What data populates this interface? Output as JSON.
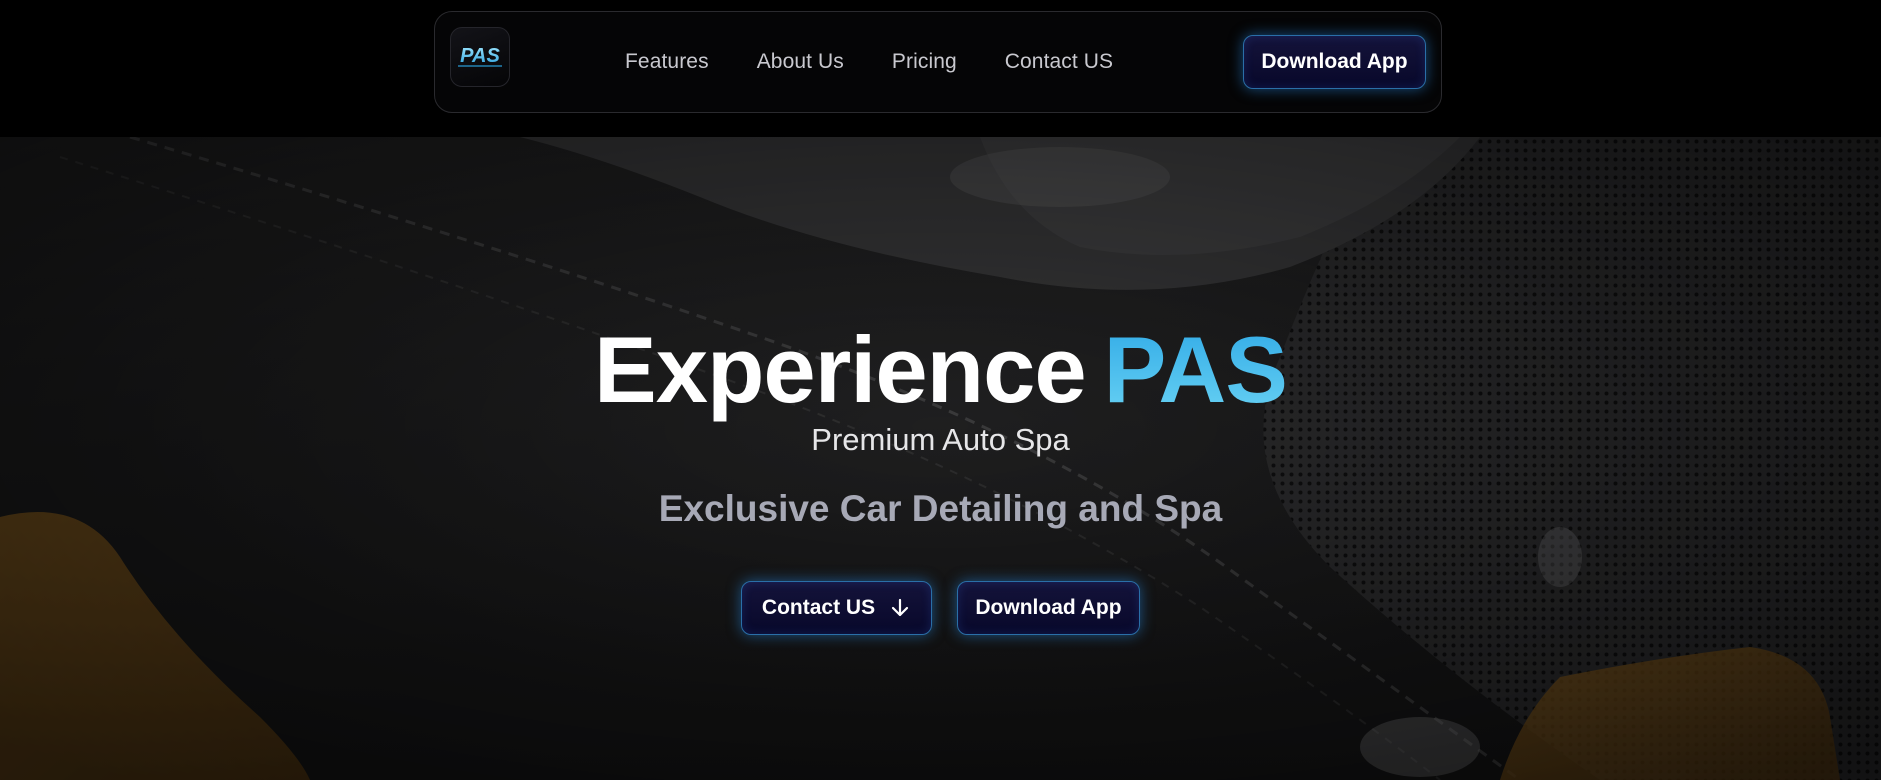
{
  "brand": {
    "logo_text": "PAS"
  },
  "nav": {
    "links": [
      {
        "label": "Features"
      },
      {
        "label": "About Us"
      },
      {
        "label": "Pricing"
      },
      {
        "label": "Contact US"
      }
    ],
    "download_label": "Download App"
  },
  "hero": {
    "title_main": "Experience",
    "title_accent": "PAS",
    "subtitle": "Premium Auto Spa",
    "tagline": "Exclusive Car Detailing and Spa",
    "contact_label": "Contact US",
    "contact_icon": "arrow-down-icon",
    "download_label": "Download App",
    "background": "car-interior-photo"
  },
  "colors": {
    "accent": "#38b2e8",
    "button_bg": "#0c0b30",
    "button_border": "#2a6fa8",
    "page_bg": "#000000"
  }
}
